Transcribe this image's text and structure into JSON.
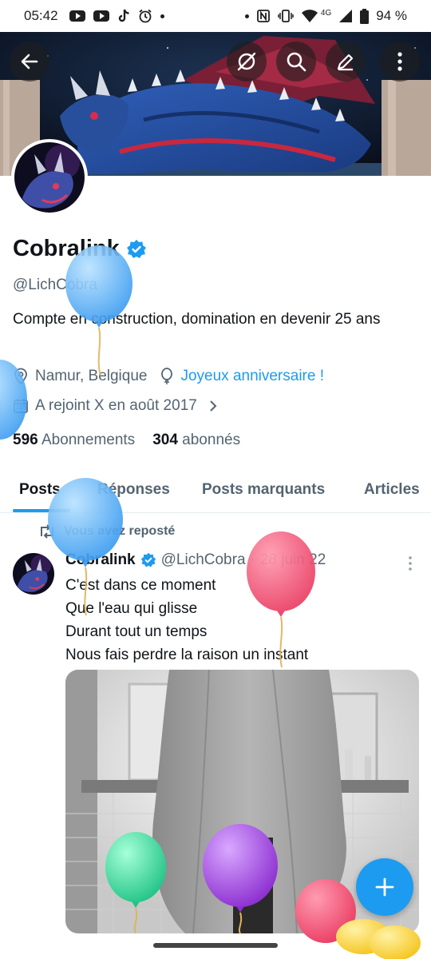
{
  "status_bar": {
    "time": "05:42",
    "network": "4G",
    "battery": "94 %"
  },
  "profile": {
    "name": "Cobralink",
    "handle": "@LichCobra",
    "bio": "Compte en construction, domination en devenir  25 ans",
    "location": "Namur, Belgique",
    "birthday_link": "Joyeux anniversaire !",
    "joined": "A rejoint X en août 2017",
    "following_count": "596",
    "following_label": "Abonnements",
    "followers_count": "304",
    "followers_label": "abonnés"
  },
  "tabs": [
    {
      "label": "Posts",
      "active": true
    },
    {
      "label": "Réponses",
      "active": false
    },
    {
      "label": "Posts marquants",
      "active": false
    },
    {
      "label": "Articles",
      "active": false
    }
  ],
  "post": {
    "repost_label": "Vous avez reposté",
    "author_name": "Cobralink",
    "author_handle": "@LichCobra",
    "separator": "·",
    "date": "28 juin 22",
    "lines": [
      "C'est dans ce moment",
      "Que l'eau qui glisse",
      "Durant tout un temps",
      "Nous fais perdre la raison un instant"
    ]
  },
  "icons": {
    "back": "arrow-left-icon",
    "grok": "grok-icon",
    "search": "search-icon",
    "edit": "edit-icon",
    "more": "more-vertical-icon",
    "location": "location-pin-icon",
    "balloon": "balloon-icon",
    "calendar": "calendar-icon",
    "chevron": "chevron-right-icon",
    "verified": "verified-badge-icon",
    "repost": "repost-icon",
    "compose": "plus-icon"
  },
  "colors": {
    "accent": "#1d9bf0",
    "text": "#0f1419",
    "secondary": "#536471"
  }
}
